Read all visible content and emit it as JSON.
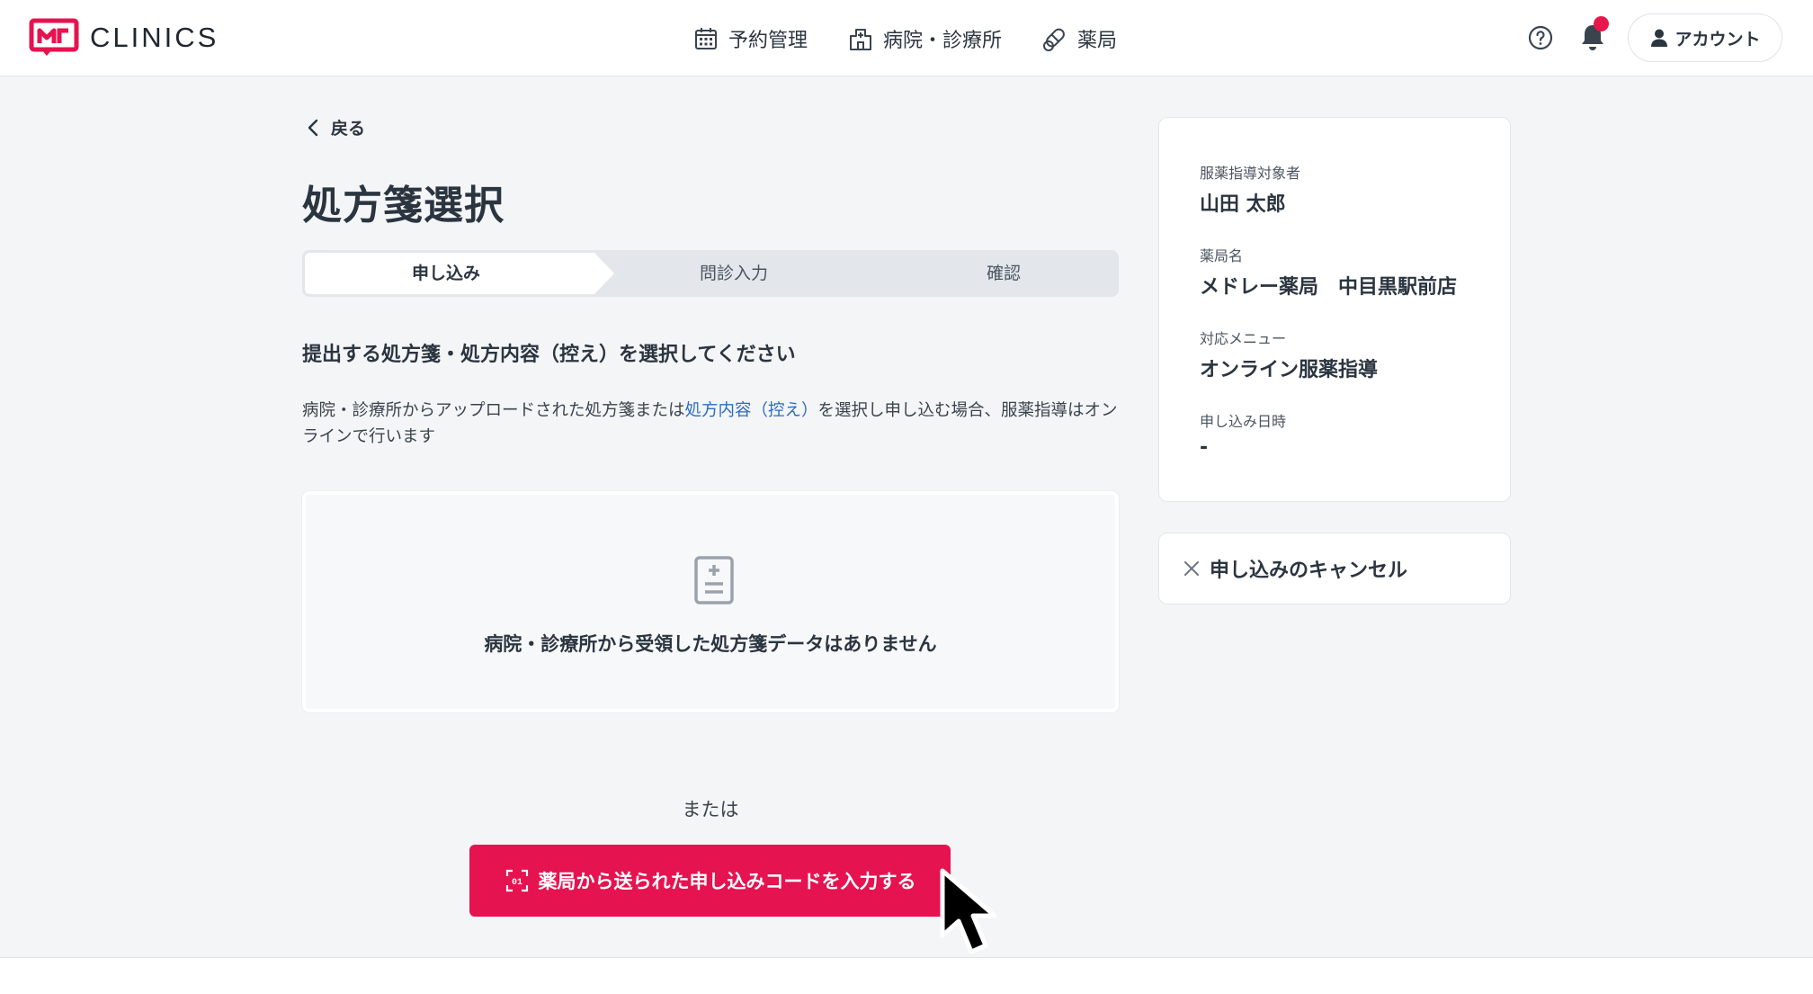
{
  "header": {
    "brand": "CLINICS",
    "nav": [
      {
        "label": "予約管理",
        "icon": "calendar-icon"
      },
      {
        "label": "病院・診療所",
        "icon": "hospital-icon"
      },
      {
        "label": "薬局",
        "icon": "pill-icon"
      }
    ],
    "account_label": "アカウント",
    "notification_dot": true
  },
  "main": {
    "back_label": "戻る",
    "title": "処方箋選択",
    "steps": [
      "申し込み",
      "問診入力",
      "確認"
    ],
    "active_step": 0,
    "section_heading": "提出する処方箋・処方内容（控え）を選択してください",
    "description_before": "病院・診療所からアップロードされた処方箋または",
    "description_link": "処方内容（控え）",
    "description_after": "を選択し申し込む場合、服薬指導はオンラインで行います",
    "empty_message": "病院・診療所から受領した処方箋データはありません",
    "or_text": "または",
    "code_button_label": "薬局から送られた申し込みコードを入力する"
  },
  "side": {
    "fields": [
      {
        "label": "服薬指導対象者",
        "value": "山田 太郎"
      },
      {
        "label": "薬局名",
        "value": "メドレー薬局　中目黒駅前店"
      },
      {
        "label": "対応メニュー",
        "value": "オンライン服薬指導"
      },
      {
        "label": "申し込み日時",
        "value": "-"
      }
    ],
    "cancel_label": "申し込みのキャンセル"
  },
  "colors": {
    "accent": "#e5134f",
    "text": "#2b3540",
    "link": "#2d6cc0",
    "background": "#f4f5f7"
  }
}
